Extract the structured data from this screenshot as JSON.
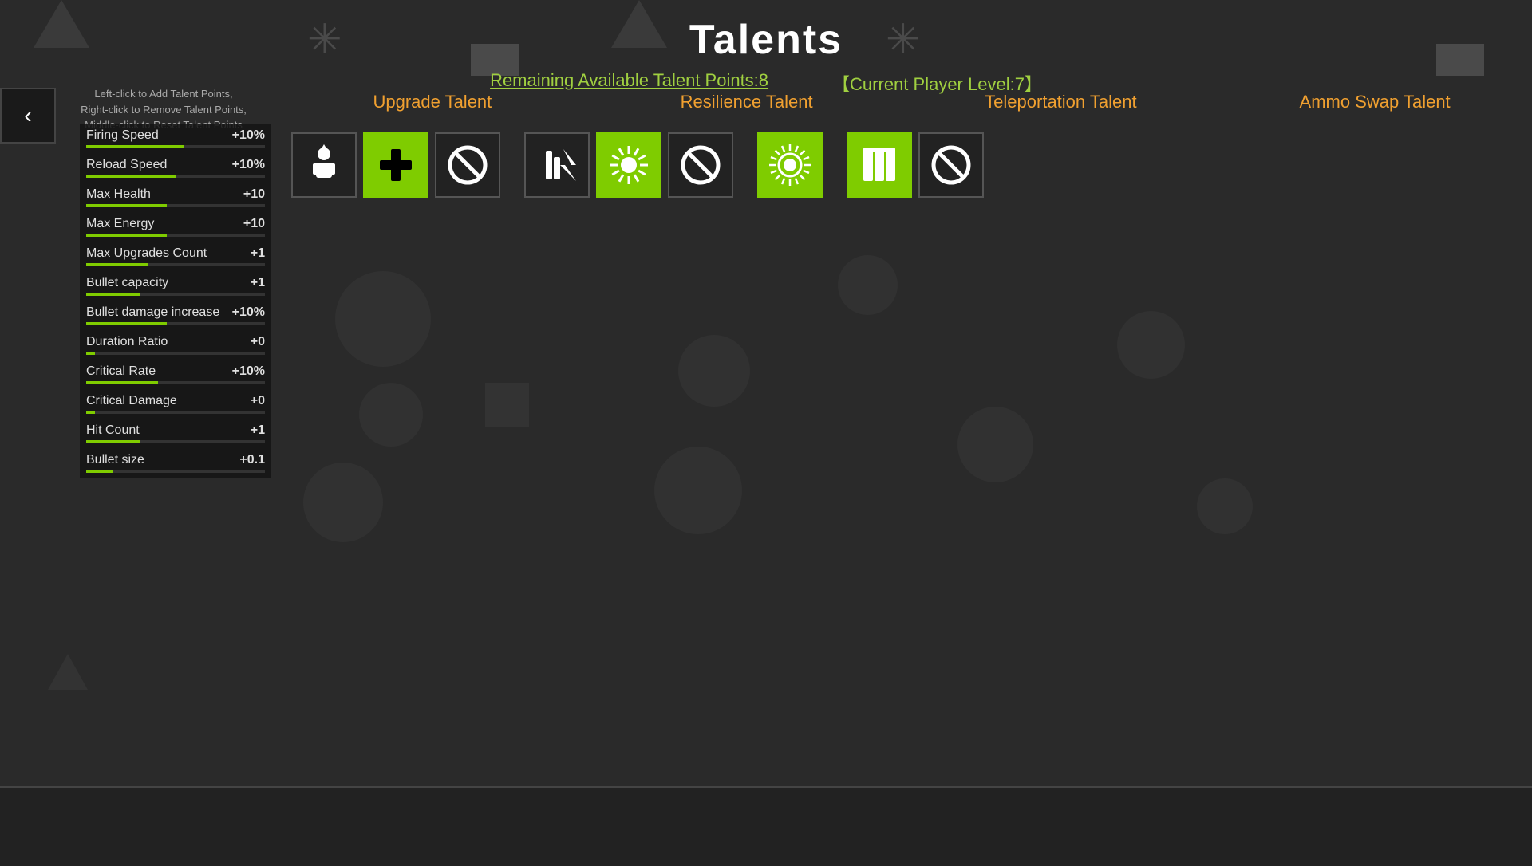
{
  "header": {
    "title": "Talents",
    "talent_points_label": "Remaining Available Talent Points:8",
    "player_level_label": "【Current Player Level:7】"
  },
  "instructions": {
    "line1": "Left-click to Add Talent Points,",
    "line2": "Right-click to Remove Talent Points,",
    "line3": "Middle-click to Reset Talent Points"
  },
  "back_button": "‹",
  "stats": [
    {
      "name": "Firing Speed",
      "value": "+10%",
      "bar": 55
    },
    {
      "name": "Reload Speed",
      "value": "+10%",
      "bar": 50
    },
    {
      "name": "Max Health",
      "value": "+10",
      "bar": 45
    },
    {
      "name": "Max Energy",
      "value": "+10",
      "bar": 45
    },
    {
      "name": "Max Upgrades Count",
      "value": "+1",
      "bar": 35
    },
    {
      "name": "Bullet capacity",
      "value": "+1",
      "bar": 30
    },
    {
      "name": "Bullet damage increase",
      "value": "+10%",
      "bar": 45
    },
    {
      "name": "Duration Ratio",
      "value": "+0",
      "bar": 5
    },
    {
      "name": "Critical Rate",
      "value": "+10%",
      "bar": 40
    },
    {
      "name": "Critical Damage",
      "value": "+0",
      "bar": 5
    },
    {
      "name": "Hit Count",
      "value": "+1",
      "bar": 30
    },
    {
      "name": "Bullet size",
      "value": "+0.1",
      "bar": 15
    }
  ],
  "talent_tabs": [
    {
      "id": "upgrade",
      "label": "Upgrade Talent"
    },
    {
      "id": "resilience",
      "label": "Resilience Talent"
    },
    {
      "id": "teleportation",
      "label": "Teleportation Talent"
    },
    {
      "id": "ammo_swap",
      "label": "Ammo Swap Talent"
    }
  ],
  "talent_groups": [
    {
      "tab": "upgrade",
      "icons": [
        {
          "id": "upgrade-player",
          "active": false,
          "symbol": "person-upgrade"
        },
        {
          "id": "upgrade-green",
          "active": true,
          "symbol": "health-cross"
        },
        {
          "id": "upgrade-block",
          "active": false,
          "symbol": "no-sign"
        }
      ]
    },
    {
      "tab": "resilience",
      "icons": [
        {
          "id": "resilience-charge",
          "active": false,
          "symbol": "charge"
        },
        {
          "id": "resilience-burst",
          "active": true,
          "symbol": "burst"
        },
        {
          "id": "resilience-block",
          "active": false,
          "symbol": "no-sign"
        }
      ]
    },
    {
      "tab": "teleportation",
      "icons": [
        {
          "id": "teleport-burst",
          "active": true,
          "symbol": "burst-ring"
        }
      ]
    },
    {
      "tab": "ammo_swap",
      "icons": [
        {
          "id": "ammo-mag",
          "active": true,
          "symbol": "magazine"
        },
        {
          "id": "ammo-block",
          "active": false,
          "symbol": "no-sign"
        }
      ]
    }
  ],
  "colors": {
    "accent_green": "#7fcc00",
    "accent_orange": "#f0a030",
    "bg_dark": "#2a2a2a",
    "bg_panel": "#1a1a1a"
  }
}
